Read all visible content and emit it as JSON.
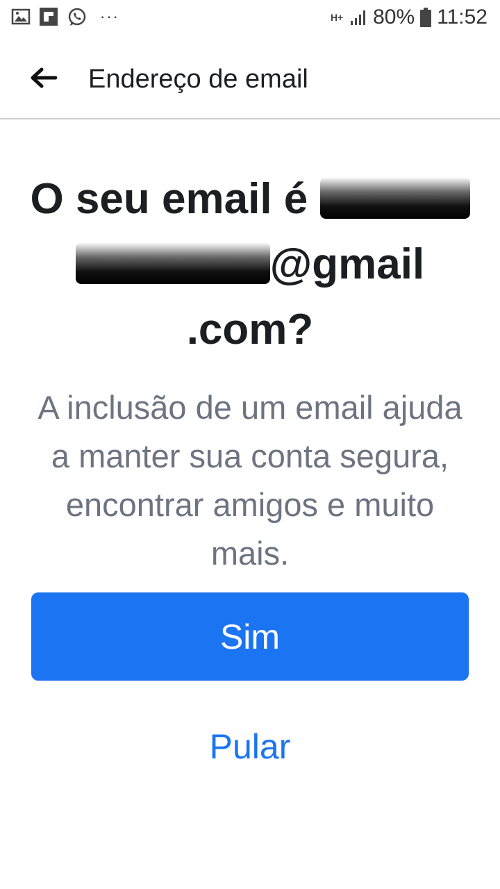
{
  "status_bar": {
    "icons_left": [
      "image-icon",
      "flipboard-icon",
      "whatsapp-icon"
    ],
    "more_indicator": "···",
    "network_type": "H+",
    "battery": "80%",
    "time": "11:52"
  },
  "app_bar": {
    "back_icon": "arrow-left-icon",
    "title": "Endereço de email"
  },
  "main": {
    "headline_prefix": "O seu email é",
    "headline_domain": "@gmail",
    "headline_suffix": ".com?",
    "description": "A inclusão de um email ajuda a manter sua conta segura, encontrar amigos e muito mais.",
    "confirm_label": "Sim",
    "skip_label": "Pular"
  },
  "colors": {
    "primary": "#1b74f2",
    "text_dark": "#1c1e21",
    "text_muted": "#6d7380",
    "divider": "#cfcfcf"
  }
}
